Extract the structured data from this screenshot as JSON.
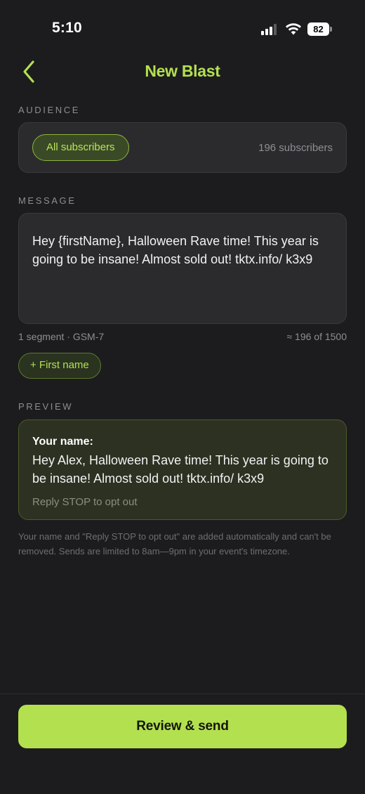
{
  "status_bar": {
    "time": "5:10",
    "battery": "82",
    "icons": [
      "signal-icon",
      "wifi-icon",
      "battery-icon"
    ]
  },
  "header": {
    "back_icon": "chevron-left-icon",
    "title": "New Blast"
  },
  "audience": {
    "label": "AUDIENCE",
    "selected": "All subscribers",
    "count": "196 subscribers"
  },
  "message": {
    "label": "MESSAGE",
    "text": "Hey {firstName}, Halloween Rave time! This year is going to be insane! Almost sold out! tktx.info/ k3x9",
    "segments": "1 segment · GSM-7",
    "recipients": "≈ 196 of 1500",
    "insert_button": "+ First name"
  },
  "preview": {
    "label": "PREVIEW",
    "name_line": "Your name:",
    "text": "Hey Alex, Halloween Rave time! This year is going to be insane! Almost sold out! tktx.info/ k3x9",
    "optout": "Reply STOP to opt out"
  },
  "footnote": "Your name and \"Reply STOP to opt out\" are added automatically and can't be removed. Sends are limited to 8am—9pm in your event's timezone.",
  "actions": {
    "review_send": "Review & send"
  },
  "colors": {
    "accent": "#b3e04f",
    "background": "#1c1c1e",
    "card": "#2b2b2e",
    "preview_card": "#2c3121"
  }
}
